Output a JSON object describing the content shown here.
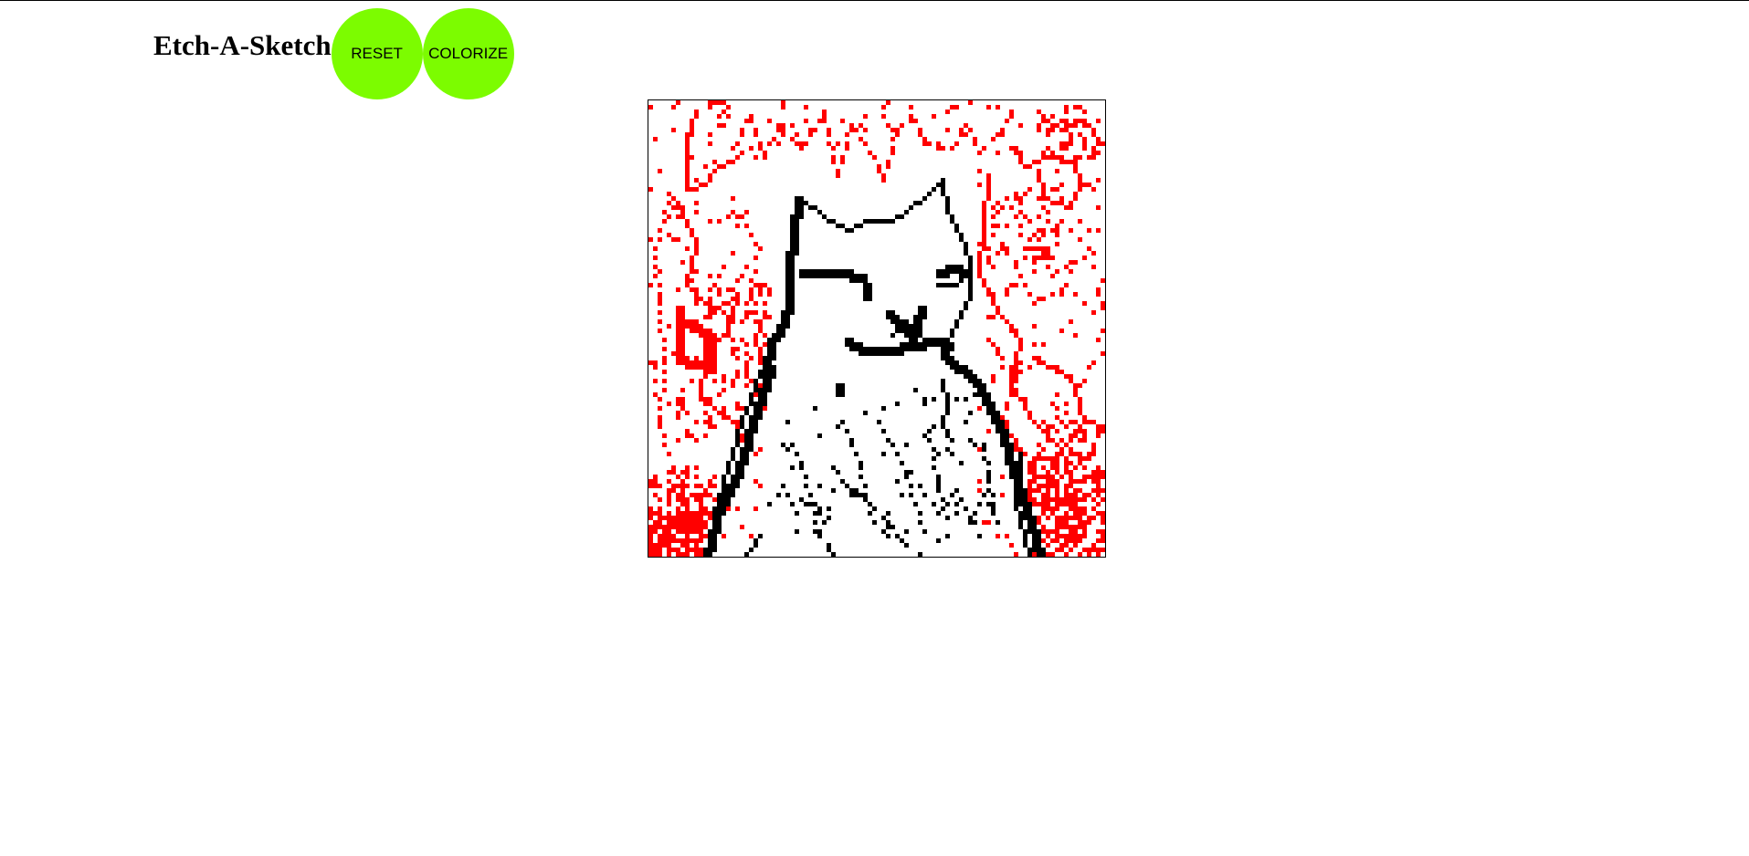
{
  "app": {
    "title": "Etch-A-Sketch"
  },
  "controls": {
    "reset_label": "RESET",
    "colorize_label": "COLORIZE",
    "button_color": "#7cfc00"
  },
  "canvas": {
    "grid_size": 100,
    "background_color": "#ffffff",
    "ink_colors": [
      "#ff0000",
      "#000000"
    ],
    "drawing": "red scribbles framing a black-outlined cat"
  }
}
